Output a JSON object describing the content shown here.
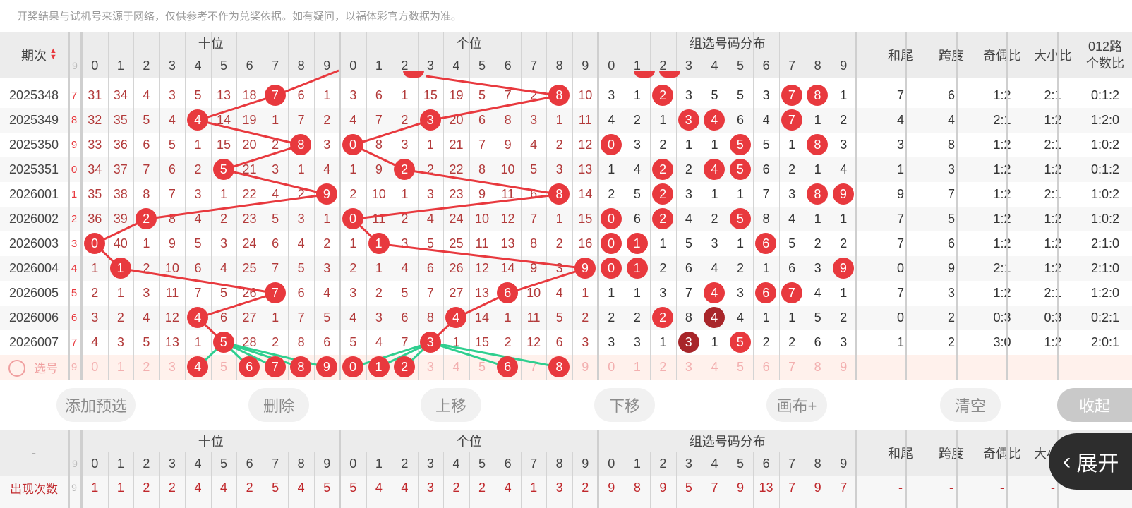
{
  "notice": "开奖结果与试机号来源于网络，仅供参考不作为兑奖依据。如有疑问，以福体彩官方数据为准。",
  "header": {
    "period_label": "期次",
    "groups": [
      "十位",
      "个位",
      "组选号码分布"
    ],
    "digits": [
      "0",
      "1",
      "2",
      "3",
      "4",
      "5",
      "6",
      "7",
      "8",
      "9"
    ],
    "stats": [
      "和尾",
      "跨度",
      "奇偶比",
      "大小比"
    ],
    "route_label_1": "012路",
    "route_label_2": "个数比"
  },
  "rows": [
    {
      "period": "2025348",
      "edge": "7",
      "ten": [
        "31",
        "34",
        "4",
        "3",
        "5",
        "13",
        "18",
        "7",
        "6",
        "1"
      ],
      "ten_hit": 7,
      "one": [
        "3",
        "6",
        "1",
        "15",
        "19",
        "5",
        "7",
        "2",
        "8",
        "10"
      ],
      "one_hit": 8,
      "grp": [
        "3",
        "1",
        "2",
        "3",
        "5",
        "5",
        "3",
        "7",
        "8",
        "1"
      ],
      "grp_hits": [
        2,
        7,
        8
      ],
      "hw": "7",
      "kd": "6",
      "jo": "1:2",
      "dx": "2:1",
      "route": "0:1:2"
    },
    {
      "period": "2025349",
      "edge": "8",
      "ten": [
        "32",
        "35",
        "5",
        "4",
        "4",
        "14",
        "19",
        "1",
        "7",
        "2"
      ],
      "ten_hit": 4,
      "one": [
        "4",
        "7",
        "2",
        "3",
        "20",
        "6",
        "8",
        "3",
        "1",
        "11"
      ],
      "one_hit": 3,
      "grp": [
        "4",
        "2",
        "1",
        "3",
        "4",
        "6",
        "4",
        "7",
        "1",
        "2"
      ],
      "grp_hits": [
        3,
        4,
        7
      ],
      "hw": "4",
      "kd": "4",
      "jo": "2:1",
      "dx": "1:2",
      "route": "1:2:0"
    },
    {
      "period": "2025350",
      "edge": "9",
      "ten": [
        "33",
        "36",
        "6",
        "5",
        "1",
        "15",
        "20",
        "2",
        "8",
        "3"
      ],
      "ten_hit": 8,
      "one": [
        "0",
        "8",
        "3",
        "1",
        "21",
        "7",
        "9",
        "4",
        "2",
        "12"
      ],
      "one_hit": 0,
      "grp": [
        "0",
        "3",
        "2",
        "1",
        "1",
        "5",
        "5",
        "1",
        "8",
        "3"
      ],
      "grp_hits": [
        0,
        5,
        8
      ],
      "hw": "3",
      "kd": "8",
      "jo": "1:2",
      "dx": "2:1",
      "route": "1:0:2"
    },
    {
      "period": "2025351",
      "edge": "0",
      "ten": [
        "34",
        "37",
        "7",
        "6",
        "2",
        "5",
        "21",
        "3",
        "1",
        "4"
      ],
      "ten_hit": 5,
      "one": [
        "1",
        "9",
        "2",
        "2",
        "22",
        "8",
        "10",
        "5",
        "3",
        "13"
      ],
      "one_hit": 2,
      "grp": [
        "1",
        "4",
        "2",
        "2",
        "4",
        "5",
        "6",
        "2",
        "1",
        "4"
      ],
      "grp_hits": [
        2,
        4,
        5
      ],
      "hw": "1",
      "kd": "3",
      "jo": "1:2",
      "dx": "1:2",
      "route": "0:1:2"
    },
    {
      "period": "2026001",
      "edge": "1",
      "ten": [
        "35",
        "38",
        "8",
        "7",
        "3",
        "1",
        "22",
        "4",
        "2",
        "9"
      ],
      "ten_hit": 9,
      "one": [
        "2",
        "10",
        "1",
        "3",
        "23",
        "9",
        "11",
        "6",
        "8",
        "14"
      ],
      "one_hit": 8,
      "grp": [
        "2",
        "5",
        "2",
        "3",
        "1",
        "1",
        "7",
        "3",
        "8",
        "9"
      ],
      "grp_hits": [
        2,
        8,
        9
      ],
      "hw": "9",
      "kd": "7",
      "jo": "1:2",
      "dx": "2:1",
      "route": "1:0:2"
    },
    {
      "period": "2026002",
      "edge": "2",
      "ten": [
        "36",
        "39",
        "2",
        "8",
        "4",
        "2",
        "23",
        "5",
        "3",
        "1"
      ],
      "ten_hit": 2,
      "one": [
        "0",
        "11",
        "2",
        "4",
        "24",
        "10",
        "12",
        "7",
        "1",
        "15"
      ],
      "one_hit": 0,
      "grp": [
        "0",
        "6",
        "2",
        "4",
        "2",
        "5",
        "8",
        "4",
        "1",
        "1"
      ],
      "grp_hits": [
        0,
        2,
        5
      ],
      "hw": "7",
      "kd": "5",
      "jo": "1:2",
      "dx": "1:2",
      "route": "1:0:2"
    },
    {
      "period": "2026003",
      "edge": "3",
      "ten": [
        "0",
        "40",
        "1",
        "9",
        "5",
        "3",
        "24",
        "6",
        "4",
        "2"
      ],
      "ten_hit": 0,
      "one": [
        "1",
        "1",
        "3",
        "5",
        "25",
        "11",
        "13",
        "8",
        "2",
        "16"
      ],
      "one_hit": 1,
      "grp": [
        "0",
        "1",
        "1",
        "5",
        "3",
        "1",
        "6",
        "5",
        "2",
        "2"
      ],
      "grp_hits": [
        0,
        1,
        6
      ],
      "hw": "7",
      "kd": "6",
      "jo": "1:2",
      "dx": "1:2",
      "route": "2:1:0"
    },
    {
      "period": "2026004",
      "edge": "4",
      "ten": [
        "1",
        "1",
        "2",
        "10",
        "6",
        "4",
        "25",
        "7",
        "5",
        "3"
      ],
      "ten_hit": 1,
      "one": [
        "2",
        "1",
        "4",
        "6",
        "26",
        "12",
        "14",
        "9",
        "3",
        "9"
      ],
      "one_hit": 9,
      "grp": [
        "0",
        "1",
        "2",
        "6",
        "4",
        "2",
        "1",
        "6",
        "3",
        "9"
      ],
      "grp_hits": [
        0,
        1,
        9
      ],
      "hw": "0",
      "kd": "9",
      "jo": "2:1",
      "dx": "1:2",
      "route": "2:1:0"
    },
    {
      "period": "2026005",
      "edge": "5",
      "ten": [
        "2",
        "1",
        "3",
        "11",
        "7",
        "5",
        "26",
        "7",
        "6",
        "4"
      ],
      "ten_hit": 7,
      "one": [
        "3",
        "2",
        "5",
        "7",
        "27",
        "13",
        "6",
        "10",
        "4",
        "1"
      ],
      "one_hit": 6,
      "grp": [
        "1",
        "1",
        "3",
        "7",
        "4",
        "3",
        "6",
        "7",
        "4",
        "1"
      ],
      "grp_hits": [
        4,
        6,
        7
      ],
      "hw": "7",
      "kd": "3",
      "jo": "1:2",
      "dx": "2:1",
      "route": "1:2:0"
    },
    {
      "period": "2026006",
      "edge": "6",
      "ten": [
        "3",
        "2",
        "4",
        "12",
        "4",
        "6",
        "27",
        "1",
        "7",
        "5"
      ],
      "ten_hit": 4,
      "one": [
        "4",
        "3",
        "6",
        "8",
        "4",
        "14",
        "1",
        "11",
        "5",
        "2"
      ],
      "one_hit": 4,
      "grp": [
        "2",
        "2",
        "2",
        "8",
        "4",
        "4",
        "1",
        "1",
        "5",
        "2"
      ],
      "grp_hits": [
        2,
        4
      ],
      "grp_dark": [
        4
      ],
      "hw": "0",
      "kd": "2",
      "jo": "0:3",
      "dx": "0:3",
      "route": "0:2:1"
    },
    {
      "period": "2026007",
      "edge": "7",
      "ten": [
        "4",
        "3",
        "5",
        "13",
        "1",
        "5",
        "28",
        "2",
        "8",
        "6"
      ],
      "ten_hit": 5,
      "one": [
        "5",
        "4",
        "7",
        "3",
        "1",
        "15",
        "2",
        "12",
        "6",
        "3"
      ],
      "one_hit": 3,
      "grp": [
        "3",
        "3",
        "1",
        "3",
        "1",
        "5",
        "2",
        "2",
        "6",
        "3"
      ],
      "grp_hits": [
        3,
        5
      ],
      "grp_dark": [
        3
      ],
      "hw": "1",
      "kd": "2",
      "jo": "3:0",
      "dx": "1:2",
      "route": "2:0:1"
    }
  ],
  "select_row": {
    "label": "选号",
    "ten_selected": [
      4,
      6,
      7,
      8,
      9
    ],
    "one_selected": [
      0,
      1,
      2,
      6,
      8
    ]
  },
  "buttons": [
    "添加预选",
    "删除",
    "上移",
    "下移",
    "画布+",
    "清空"
  ],
  "collapse_label": "收起",
  "expand_label": "展开",
  "footer": {
    "dash": "-",
    "count_label": "出现次数",
    "ten_counts": [
      "1",
      "1",
      "2",
      "2",
      "4",
      "4",
      "2",
      "5",
      "4",
      "5"
    ],
    "one_counts": [
      "5",
      "4",
      "4",
      "3",
      "2",
      "2",
      "4",
      "1",
      "3",
      "2"
    ],
    "grp_counts": [
      "9",
      "8",
      "9",
      "5",
      "7",
      "9",
      "13",
      "7",
      "9",
      "7"
    ],
    "stats_counts": [
      "-",
      "-",
      "-",
      "-",
      "-"
    ]
  },
  "colors": {
    "ball": "#e8393e",
    "ball_dark": "#a8262a",
    "line_red": "#e8393e",
    "line_green": "#2fcf8f",
    "number": "#b23a3a",
    "header_bg": "#ececec"
  }
}
